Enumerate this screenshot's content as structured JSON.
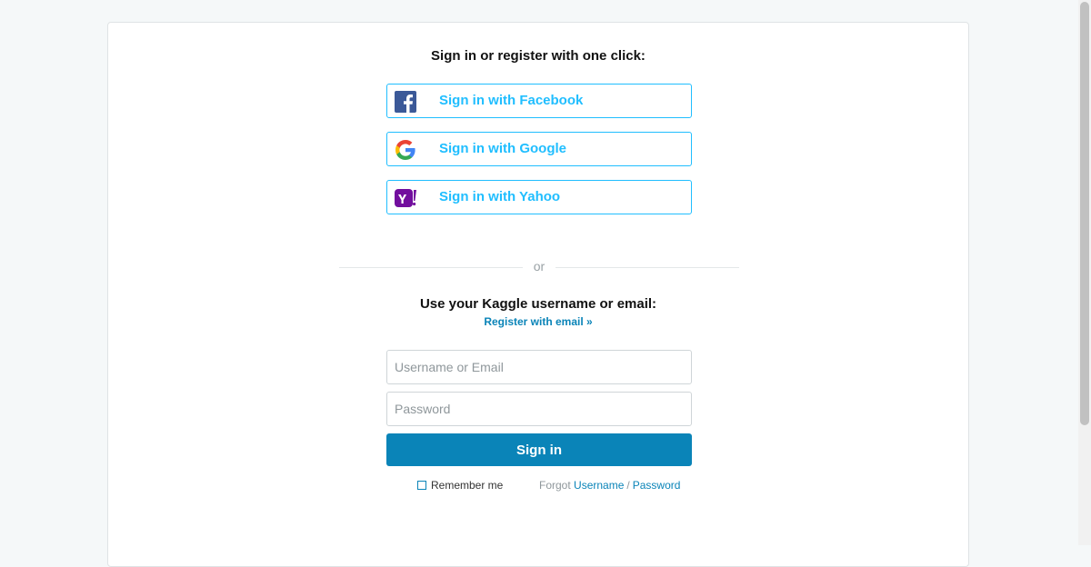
{
  "social_section": {
    "heading": "Sign in or register with one click:",
    "buttons": [
      {
        "label": "Sign in with Facebook",
        "icon": "facebook-icon"
      },
      {
        "label": "Sign in with Google",
        "icon": "google-icon"
      },
      {
        "label": "Sign in with Yahoo",
        "icon": "yahoo-icon"
      }
    ]
  },
  "divider": {
    "text": "or"
  },
  "login_section": {
    "heading": "Use your Kaggle username or email:",
    "register_link": "Register with email »",
    "username_placeholder": "Username or Email",
    "password_placeholder": "Password",
    "signin_label": "Sign in",
    "remember_label": "Remember me",
    "forgot_prefix": "Forgot",
    "forgot_username": "Username",
    "forgot_separator": "/",
    "forgot_password": "Password"
  },
  "colors": {
    "accent": "#20beff",
    "primary_button": "#0a84b8",
    "facebook": "#3b5998",
    "yahoo": "#720e9e"
  }
}
